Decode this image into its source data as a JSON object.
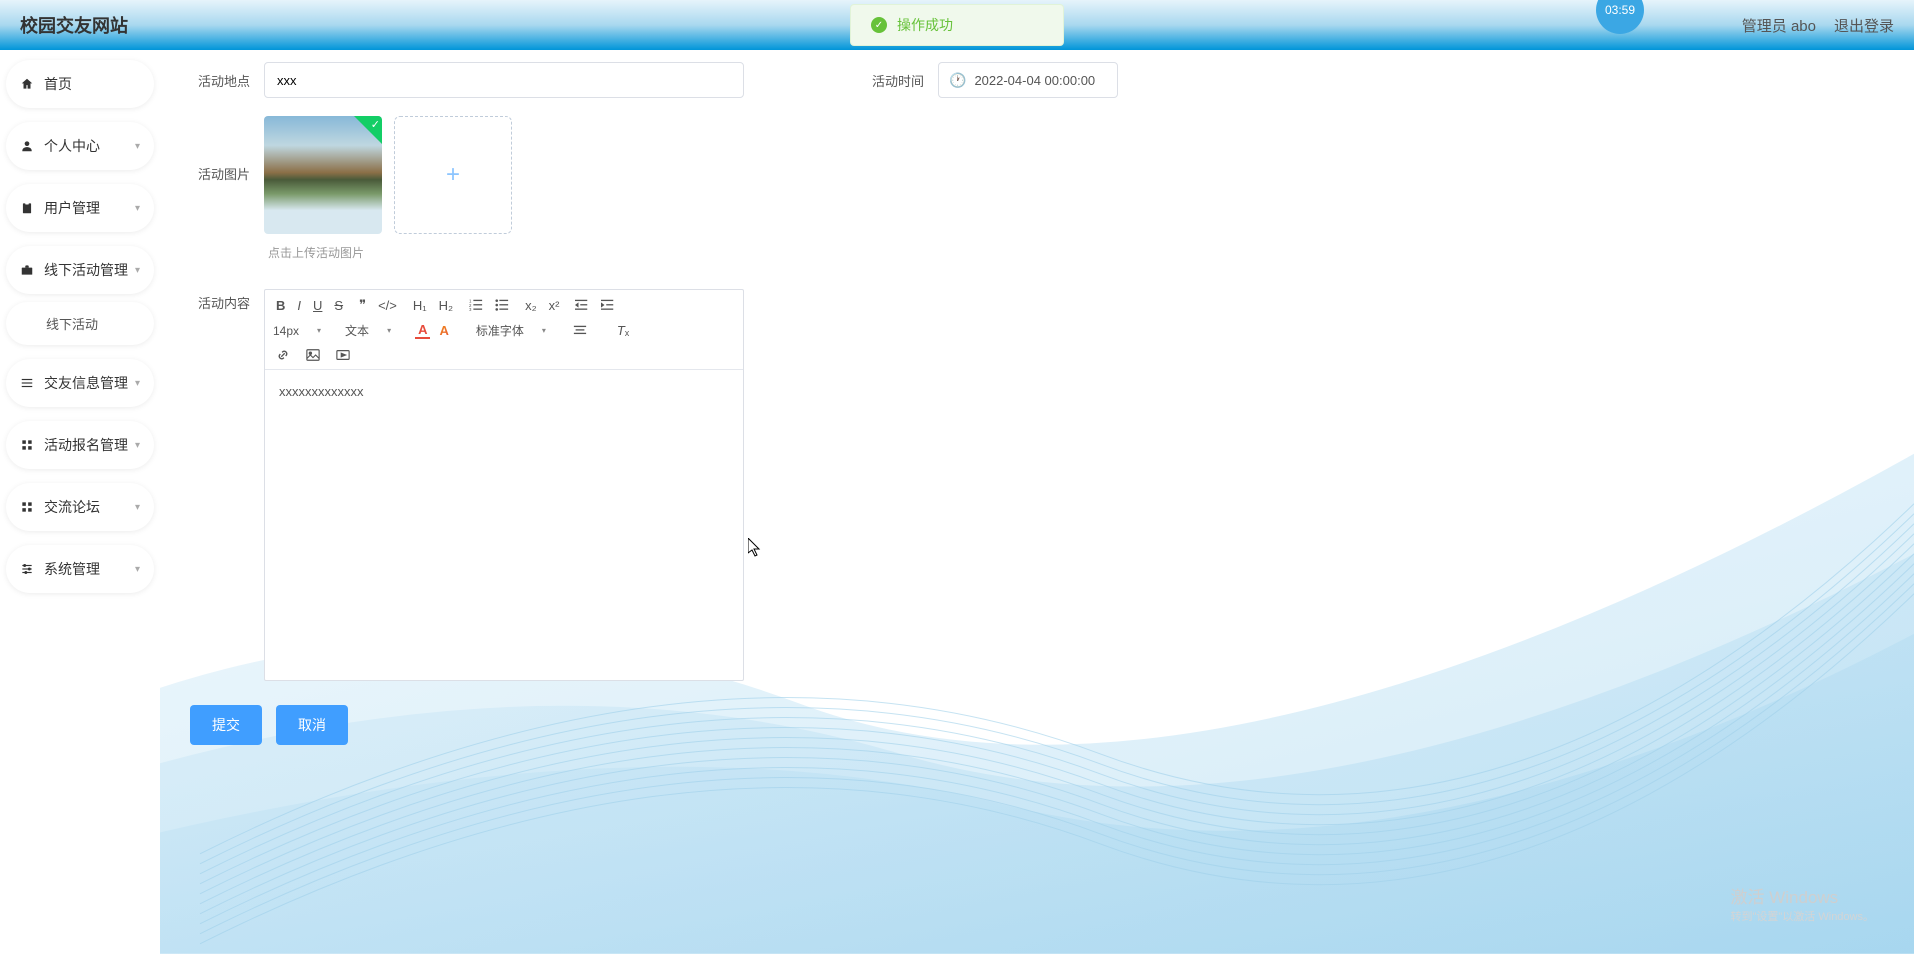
{
  "header": {
    "title": "校园交友网站",
    "clock": "03:59",
    "user": "管理员 abo",
    "logout": "退出登录"
  },
  "toast": {
    "message": "操作成功"
  },
  "sidebar": {
    "home": "首页",
    "profile": "个人中心",
    "userMgmt": "用户管理",
    "offlineMgmt": "线下活动管理",
    "offlineSub": "线下活动",
    "friendMgmt": "交友信息管理",
    "signupMgmt": "活动报名管理",
    "forum": "交流论坛",
    "sysMgmt": "系统管理"
  },
  "form": {
    "locationLabel": "活动地点",
    "locationValue": "xxx",
    "timeLabel": "活动时间",
    "timeValue": "2022-04-04 00:00:00",
    "imageLabel": "活动图片",
    "imageHint": "点击上传活动图片",
    "contentLabel": "活动内容",
    "contentValue": "xxxxxxxxxxxxx"
  },
  "editor": {
    "fontSize": "14px",
    "textType": "文本",
    "fontFamily": "标准字体"
  },
  "buttons": {
    "submit": "提交",
    "cancel": "取消"
  },
  "watermark": {
    "line1": "激活 Windows",
    "line2": "转到\"设置\"以激活 Windows。"
  }
}
